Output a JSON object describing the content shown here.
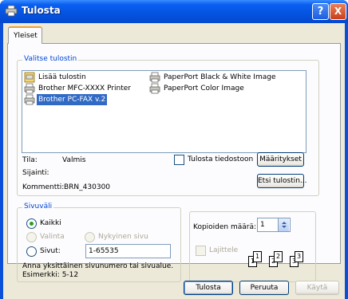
{
  "window": {
    "title": "Tulosta",
    "help_label": "?",
    "close_label": "X"
  },
  "tabs": [
    {
      "label": "Yleiset",
      "active": true
    }
  ],
  "printer_group": {
    "legend": "Valitse tulostin",
    "printers": [
      {
        "label": "Lisää tulostin",
        "icon": "add-printer-icon",
        "selected": false
      },
      {
        "label": "Brother MFC-XXXX  Printer",
        "icon": "printer-icon",
        "selected": false
      },
      {
        "label": "Brother PC-FAX v.2",
        "icon": "fax-printer-icon",
        "selected": true
      },
      {
        "label": "PaperPort Black & White Image",
        "icon": "printer-icon",
        "selected": false
      },
      {
        "label": "PaperPort Color Image",
        "icon": "printer-icon",
        "selected": false
      }
    ],
    "status_label": "Tila:",
    "status_value": "Valmis",
    "location_label": "Sijainti:",
    "location_value": "",
    "comment_label": "Kommentti:",
    "comment_value": "BRN_430300",
    "print_to_file_label": "Tulosta tiedostoon",
    "print_to_file_checked": false,
    "preferences_button": "Määritykset",
    "find_printer_button": "Etsi tulostin..."
  },
  "page_range": {
    "legend": "Sivuväli",
    "all_label": "Kaikki",
    "selection_label": "Valinta",
    "current_page_label": "Nykyinen sivu",
    "pages_label": "Sivut:",
    "pages_value": "1-65535",
    "selected": "all",
    "hint_line1": "Anna yksittäinen sivunumero tai sivualue.",
    "hint_line2": "Esimerkki: 5-12"
  },
  "copies": {
    "label": "Kopioiden määrä:",
    "value": "1",
    "collate_label": "Lajittele",
    "collate_checked": false,
    "collate_pages": [
      "1",
      "1",
      "2",
      "2",
      "3",
      "3"
    ]
  },
  "buttons": {
    "print": "Tulosta",
    "cancel": "Peruuta",
    "apply": "Käytä"
  }
}
